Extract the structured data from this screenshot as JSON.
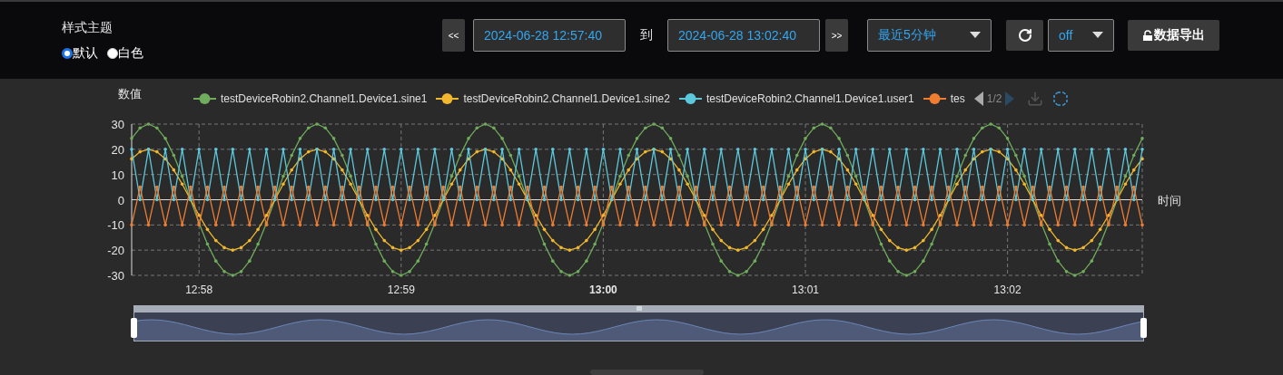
{
  "theme": {
    "label": "样式主题",
    "options": [
      {
        "label": "默认",
        "selected": true
      },
      {
        "label": "白色",
        "selected": false
      }
    ]
  },
  "time_range": {
    "prev": "<<",
    "start": "2024-06-28 12:57:40",
    "separator": "到",
    "end": "2024-06-28 13:02:40",
    "next": ">>",
    "preset": "最近5分钟",
    "refresh_interval": "off",
    "export": "数据导出"
  },
  "chart": {
    "legend_page": "1/2",
    "chart_data": {
      "type": "line",
      "grid": true,
      "xlabel": "时间",
      "ylabel": "数值",
      "xlim": [
        46660,
        46960
      ],
      "ylim": [
        -30,
        30
      ],
      "yticks": [
        -30,
        -20,
        -10,
        0,
        10,
        20,
        30
      ],
      "xticks": [
        {
          "value": 46680,
          "label": "12:58"
        },
        {
          "value": 46740,
          "label": "12:59"
        },
        {
          "value": 46800,
          "label": "13:00"
        },
        {
          "value": 46860,
          "label": "13:01"
        },
        {
          "value": 46920,
          "label": "13:02"
        }
      ],
      "x": [
        46660,
        46662.5,
        46665,
        46667.5,
        46670,
        46672.5,
        46675,
        46677.5,
        46680,
        46682.5,
        46685,
        46687.5,
        46690,
        46692.5,
        46695,
        46697.5,
        46700,
        46702.5,
        46705,
        46707.5,
        46710,
        46712.5,
        46715,
        46717.5,
        46720,
        46722.5,
        46725,
        46727.5,
        46730,
        46732.5,
        46735,
        46737.5,
        46740,
        46742.5,
        46745,
        46747.5,
        46750,
        46752.5,
        46755,
        46757.5,
        46760,
        46762.5,
        46765,
        46767.5,
        46770,
        46772.5,
        46775,
        46777.5,
        46780,
        46782.5,
        46785,
        46787.5,
        46790,
        46792.5,
        46795,
        46797.5,
        46800,
        46802.5,
        46805,
        46807.5,
        46810,
        46812.5,
        46815,
        46817.5,
        46820,
        46822.5,
        46825,
        46827.5,
        46830,
        46832.5,
        46835,
        46837.5,
        46840,
        46842.5,
        46845,
        46847.5,
        46850,
        46852.5,
        46855,
        46857.5,
        46860,
        46862.5,
        46865,
        46867.5,
        46870,
        46872.5,
        46875,
        46877.5,
        46880,
        46882.5,
        46885,
        46887.5,
        46890,
        46892.5,
        46895,
        46897.5,
        46900,
        46902.5,
        46905,
        46907.5,
        46910,
        46912.5,
        46915,
        46917.5,
        46920,
        46922.5,
        46925,
        46927.5,
        46930,
        46932.5,
        46935,
        46937.5,
        46940,
        46942.5,
        46945,
        46947.5,
        46950,
        46952.5,
        46955,
        46957.5,
        46960
      ],
      "series": [
        {
          "name": "testDeviceRobin2.Channel1.Device1.sine1",
          "color": "#6fac5c",
          "values": [
            24.3,
            28.5,
            30,
            28.5,
            24.3,
            17.6,
            9.3,
            0,
            -9.3,
            -17.6,
            -24.3,
            -28.5,
            -30,
            -28.5,
            -24.3,
            -17.6,
            -9.3,
            0,
            9.3,
            17.6,
            24.3,
            28.5,
            30,
            28.5,
            24.3,
            17.6,
            9.3,
            0,
            -9.3,
            -17.6,
            -24.3,
            -28.5,
            -30,
            -28.5,
            -24.3,
            -17.6,
            -9.3,
            0,
            9.3,
            17.6,
            24.3,
            28.5,
            30,
            28.5,
            24.3,
            17.6,
            9.3,
            0,
            -9.3,
            -17.6,
            -24.3,
            -28.5,
            -30,
            -28.5,
            -24.3,
            -17.6,
            -9.3,
            0,
            9.3,
            17.6,
            24.3,
            28.5,
            30,
            28.5,
            24.3,
            17.6,
            9.3,
            0,
            -9.3,
            -17.6,
            -24.3,
            -28.5,
            -30,
            -28.5,
            -24.3,
            -17.6,
            -9.3,
            0,
            9.3,
            17.6,
            24.3,
            28.5,
            30,
            28.5,
            24.3,
            17.6,
            9.3,
            0,
            -9.3,
            -17.6,
            -24.3,
            -28.5,
            -30,
            -28.5,
            -24.3,
            -17.6,
            -9.3,
            0,
            9.3,
            17.6,
            24.3,
            28.5,
            30,
            28.5,
            24.3,
            17.6,
            9.3,
            0,
            -9.3,
            -17.6,
            -24.3,
            -28.5,
            -30,
            -28.5,
            -24.3,
            -17.6,
            -9.3,
            0,
            9.3,
            17.6,
            24.3
          ]
        },
        {
          "name": "testDeviceRobin2.Channel1.Device1.sine2",
          "color": "#f0b72f",
          "values": [
            16.2,
            19,
            20,
            19,
            16.2,
            11.8,
            6.2,
            0,
            -6.2,
            -11.8,
            -16.2,
            -19,
            -20,
            -19,
            -16.2,
            -11.8,
            -6.2,
            0,
            6.2,
            11.8,
            16.2,
            19,
            20,
            19,
            16.2,
            11.8,
            6.2,
            0,
            -6.2,
            -11.8,
            -16.2,
            -19,
            -20,
            -19,
            -16.2,
            -11.8,
            -6.2,
            0,
            6.2,
            11.8,
            16.2,
            19,
            20,
            19,
            16.2,
            11.8,
            6.2,
            0,
            -6.2,
            -11.8,
            -16.2,
            -19,
            -20,
            -19,
            -16.2,
            -11.8,
            -6.2,
            0,
            6.2,
            11.8,
            16.2,
            19,
            20,
            19,
            16.2,
            11.8,
            6.2,
            0,
            -6.2,
            -11.8,
            -16.2,
            -19,
            -20,
            -19,
            -16.2,
            -11.8,
            -6.2,
            0,
            6.2,
            11.8,
            16.2,
            19,
            20,
            19,
            16.2,
            11.8,
            6.2,
            0,
            -6.2,
            -11.8,
            -16.2,
            -19,
            -20,
            -19,
            -16.2,
            -11.8,
            -6.2,
            0,
            6.2,
            11.8,
            16.2,
            19,
            20,
            19,
            16.2,
            11.8,
            6.2,
            0,
            -6.2,
            -11.8,
            -16.2,
            -19,
            -20,
            -19,
            -16.2,
            -11.8,
            -6.2,
            0,
            6.2,
            11.8,
            16.2
          ]
        },
        {
          "name": "testDeviceRobin2.Channel1.Device1.user1",
          "color": "#5bc8dc",
          "values": [
            20,
            0,
            20,
            0,
            20,
            0,
            20,
            0,
            20,
            0,
            20,
            0,
            20,
            0,
            20,
            0,
            20,
            0,
            20,
            0,
            20,
            0,
            20,
            0,
            20,
            0,
            20,
            0,
            20,
            0,
            20,
            0,
            20,
            0,
            20,
            0,
            20,
            0,
            20,
            0,
            20,
            0,
            20,
            0,
            20,
            0,
            20,
            0,
            20,
            0,
            20,
            0,
            20,
            0,
            20,
            0,
            20,
            0,
            20,
            0,
            20,
            0,
            20,
            0,
            20,
            0,
            20,
            0,
            20,
            0,
            20,
            0,
            20,
            0,
            20,
            0,
            20,
            0,
            20,
            0,
            20,
            0,
            20,
            0,
            20,
            0,
            20,
            0,
            20,
            0,
            20,
            0,
            20,
            0,
            20,
            0,
            20,
            0,
            20,
            0,
            20,
            0,
            20,
            0,
            20,
            0,
            20,
            0,
            20,
            0,
            20,
            0,
            20,
            0,
            20,
            0,
            20,
            0,
            20,
            0,
            20
          ]
        },
        {
          "name": "tes",
          "color": "#ee7d31",
          "values": [
            -10,
            5,
            -10,
            5,
            -10,
            5,
            -10,
            5,
            -10,
            5,
            -10,
            5,
            -10,
            5,
            -10,
            5,
            -10,
            5,
            -10,
            5,
            -10,
            5,
            -10,
            5,
            -10,
            5,
            -10,
            5,
            -10,
            5,
            -10,
            5,
            -10,
            5,
            -10,
            5,
            -10,
            5,
            -10,
            5,
            -10,
            5,
            -10,
            5,
            -10,
            5,
            -10,
            5,
            -10,
            5,
            -10,
            5,
            -10,
            5,
            -10,
            5,
            -10,
            5,
            -10,
            5,
            -10,
            5,
            -10,
            5,
            -10,
            5,
            -10,
            5,
            -10,
            5,
            -10,
            5,
            -10,
            5,
            -10,
            5,
            -10,
            5,
            -10,
            5,
            -10,
            5,
            -10,
            5,
            -10,
            5,
            -10,
            5,
            -10,
            5,
            -10,
            5,
            -10,
            5,
            -10,
            5,
            -10,
            5,
            -10,
            5,
            -10,
            5,
            -10,
            5,
            -10,
            5,
            -10,
            5,
            -10,
            5,
            -10,
            5,
            -10,
            5,
            -10,
            5,
            -10,
            5,
            -10,
            5,
            -10
          ]
        }
      ]
    }
  }
}
